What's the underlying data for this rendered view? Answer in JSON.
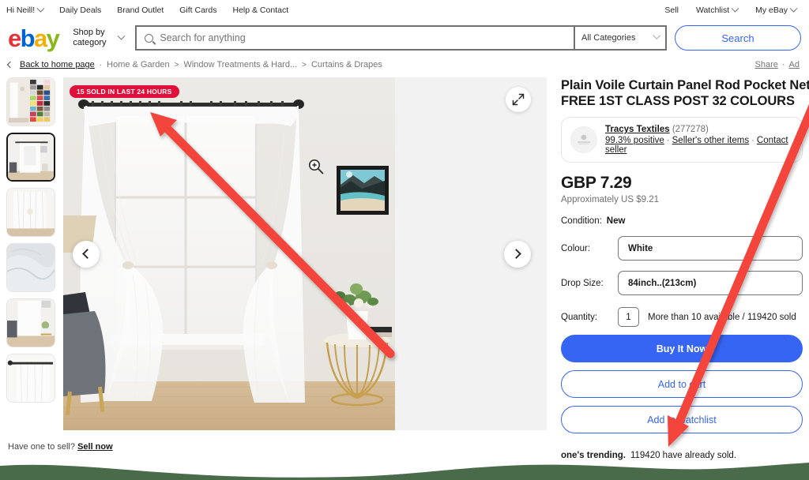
{
  "globalnav": {
    "left": [
      {
        "label": "Hi Neill!",
        "caret": true
      },
      {
        "label": "Daily Deals",
        "caret": false
      },
      {
        "label": "Brand Outlet",
        "caret": false
      },
      {
        "label": "Gift Cards",
        "caret": false
      },
      {
        "label": "Help & Contact",
        "caret": false
      }
    ],
    "right": [
      {
        "label": "Sell",
        "caret": false
      },
      {
        "label": "Watchlist",
        "caret": true
      },
      {
        "label": "My eBay",
        "caret": true
      }
    ]
  },
  "header": {
    "logo": [
      "e",
      "b",
      "a",
      "y"
    ],
    "shop_by_category": "Shop by\ncategory",
    "shop_by_line1": "Shop by",
    "shop_by_line2": "category",
    "search_placeholder": "Search for anything",
    "search_value": "",
    "category_selected": "All Categories",
    "search_button": "Search",
    "search_icon": "search-icon"
  },
  "breadcrumb": {
    "back_label": "Back to home page",
    "items": [
      "Home & Garden",
      "Window Treatments & Hard...",
      "Curtains & Drapes"
    ],
    "right_links": [
      "Share",
      "Ad"
    ]
  },
  "gallery": {
    "sold_badge": "15 SOLD IN LAST 24 HOURS",
    "prev_icon": "chevron-left-icon",
    "next_icon": "chevron-right-icon",
    "expand_icon": "expand-icon",
    "zoom_icon": "magnifier-plus-icon",
    "thumbnails": [
      {
        "name": "thumb-colour-chart",
        "selected": false
      },
      {
        "name": "thumb-white-curtain-room",
        "selected": true
      },
      {
        "name": "thumb-curtain-closeup",
        "selected": false
      },
      {
        "name": "thumb-fabric-texture",
        "selected": false
      },
      {
        "name": "thumb-living-room",
        "selected": false
      },
      {
        "name": "thumb-rod-detail",
        "selected": false
      }
    ]
  },
  "product": {
    "title_line1": "Plain Voile Curtain Panel Rod Pocket Net Slo",
    "title_line2": "FREE 1ST CLASS POST 32 COLOURS",
    "seller": {
      "name": "Tracys Textiles",
      "feedback_count": "(277278)",
      "positive": "99.3% positive",
      "other_items": "Seller's other items",
      "contact": "Contact seller",
      "avatar_icon": "seller-avatar-icon"
    },
    "price": "GBP 7.29",
    "approx_price": "Approximately US $9.21",
    "condition_label": "Condition:",
    "condition_value": "New",
    "variations": [
      {
        "label": "Colour:",
        "value": "White",
        "name": "colour-select"
      },
      {
        "label": "Drop Size:",
        "value": "84inch..(213cm)",
        "name": "drop-size-select"
      }
    ],
    "quantity_label": "Quantity:",
    "quantity_value": "1",
    "quantity_info": "More than 10 available / 119420 sold",
    "buttons": {
      "buy_now": "Buy It Now",
      "add_cart": "Add to cart",
      "add_watchlist": "Add to watchlist"
    },
    "trending_strong": "one's trending.",
    "trending_rest": "119420 have already sold."
  },
  "footer": {
    "have_one_text": "Have one to sell?",
    "sell_now": "Sell now"
  },
  "colors": {
    "accent_blue": "#3665f3",
    "badge_red": "#e0103a",
    "annotation_red": "#f4453c",
    "bottom_green": "#4a6b4a",
    "logo_red": "#e53238",
    "logo_blue": "#0064d2",
    "logo_yellow": "#f5af02",
    "logo_green": "#86b817"
  }
}
